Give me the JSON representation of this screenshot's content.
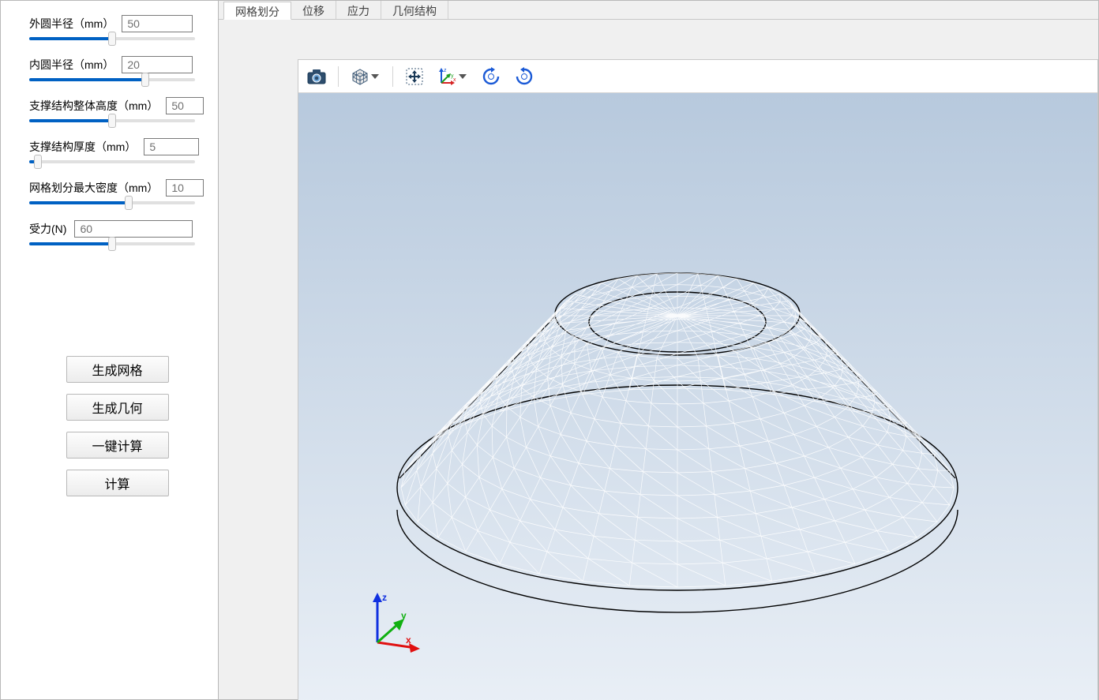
{
  "sidebar": {
    "params": [
      {
        "label": "外圆半径（mm）",
        "value": "50",
        "slider": 50
      },
      {
        "label": "内圆半径（mm）",
        "value": "20",
        "slider": 70
      },
      {
        "label": "支撑结构整体高度（mm）",
        "value": "50",
        "slider": 50
      },
      {
        "label": "支撑结构厚度（mm）",
        "value": "5",
        "slider": 5
      },
      {
        "label": "网格划分最大密度（mm）",
        "value": "10",
        "slider": 60
      }
    ],
    "force": {
      "label": "受力(N)",
      "value": "60",
      "slider": 50
    },
    "buttons": {
      "generate_mesh": "生成网格",
      "generate_geometry": "生成几何",
      "one_click_calc": "一键计算",
      "calc": "计算"
    }
  },
  "tabs": [
    {
      "key": "mesh",
      "label": "网格划分",
      "active": true
    },
    {
      "key": "displacement",
      "label": "位移",
      "active": false
    },
    {
      "key": "stress",
      "label": "应力",
      "active": false
    },
    {
      "key": "geometry",
      "label": "几何结构",
      "active": false
    }
  ],
  "toolbar": {
    "icons": {
      "camera": "camera-icon",
      "cube": "cube-icon",
      "move": "move-icon",
      "axes": "axes-icon",
      "rotate_cw": "rotate-cw-icon",
      "rotate_ccw": "rotate-ccw-icon"
    }
  },
  "viewport": {
    "axes": {
      "x": "x",
      "y": "y",
      "z": "z"
    }
  },
  "colors": {
    "accent": "#0061c3"
  }
}
